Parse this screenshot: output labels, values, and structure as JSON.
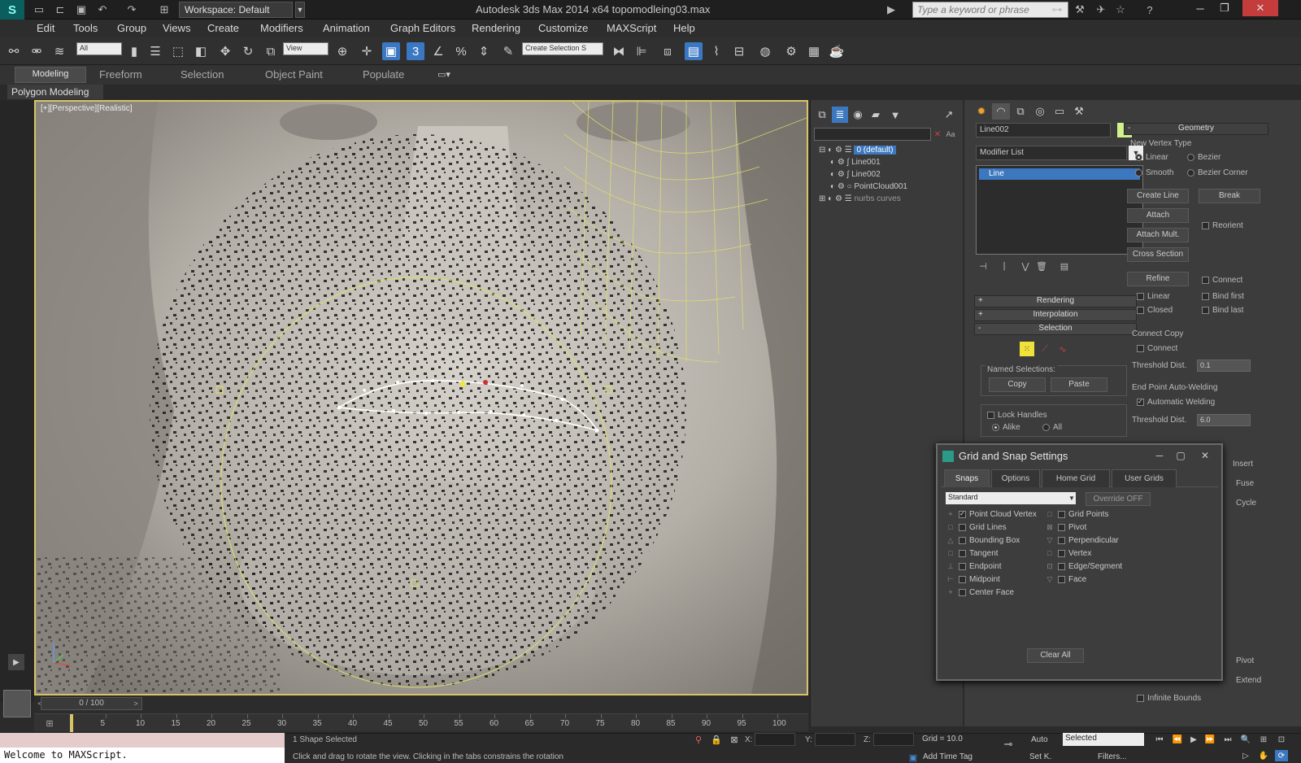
{
  "titlebar": {
    "workspace": "Workspace: Default",
    "title": "Autodesk 3ds Max  2014 x64      topomodleing03.max",
    "search_placeholder": "Type a keyword or phrase"
  },
  "menu": [
    "Edit",
    "Tools",
    "Group",
    "Views",
    "Create",
    "Modifiers",
    "Animation",
    "Graph Editors",
    "Rendering",
    "Customize",
    "MAXScript",
    "Help"
  ],
  "toolbar": {
    "filter_select": "All",
    "ref_coord_select": "View",
    "named_selection": "Create Selection S"
  },
  "ribbon": {
    "tabs": [
      "Modeling",
      "Freeform",
      "Selection",
      "Object Paint",
      "Populate"
    ],
    "panel_label": "Polygon Modeling"
  },
  "viewport": {
    "label": "[+][Perspective][Realistic]"
  },
  "timeline": {
    "slider": "0 / 100",
    "ticks": [
      "5",
      "10",
      "15",
      "20",
      "25",
      "30",
      "35",
      "40",
      "45",
      "50",
      "55",
      "60",
      "65",
      "70",
      "75",
      "80",
      "85",
      "90",
      "95",
      "100"
    ]
  },
  "scene_explorer": {
    "items": [
      "0 (default)",
      "Line001",
      "Line002",
      "PointCloud001",
      "nurbs curves"
    ]
  },
  "command_panel": {
    "object_name": "Line002",
    "modifier_list": "Modifier List",
    "stack_item": "Line",
    "rollouts": {
      "rendering": "Rendering",
      "interpolation": "Interpolation",
      "selection": "Selection"
    },
    "selection": {
      "named_selections": "Named Selections:",
      "copy": "Copy",
      "paste": "Paste",
      "lock_handles": "Lock Handles",
      "alike": "Alike",
      "all": "All"
    },
    "geometry": {
      "title": "Geometry",
      "new_vertex_type": "New Vertex Type",
      "linear": "Linear",
      "bezier": "Bezier",
      "smooth": "Smooth",
      "bezier_corner": "Bezier Corner",
      "create_line": "Create Line",
      "break": "Break",
      "attach": "Attach",
      "reorient": "Reorient",
      "attach_mult": "Attach Mult.",
      "cross_section": "Cross Section",
      "refine": "Refine",
      "connect": "Connect",
      "linear2": "Linear",
      "bind_first": "Bind first",
      "closed": "Closed",
      "bind_last": "Bind last",
      "connect_copy": "Connect Copy",
      "connect2": "Connect",
      "threshold_dist": "Threshold Dist.",
      "threshold_val1": "0.1",
      "end_point_welding": "End Point Auto-Welding",
      "automatic_welding": "Automatic Welding",
      "threshold_val2": "6.0",
      "insert": "Insert",
      "fuse": "Fuse",
      "cycle": "Cycle",
      "pivot": "Pivot",
      "extend": "Extend",
      "infinite_bounds": "Infinite Bounds"
    }
  },
  "grid_dialog": {
    "title": "Grid and Snap Settings",
    "tabs": [
      "Snaps",
      "Options",
      "Home Grid",
      "User Grids"
    ],
    "preset": "Standard",
    "override": "Override OFF",
    "left_snaps": [
      {
        "label": "Point Cloud Vertex",
        "checked": true,
        "glyph": "+"
      },
      {
        "label": "Grid Lines",
        "checked": false,
        "glyph": "□"
      },
      {
        "label": "Bounding Box",
        "checked": false,
        "glyph": "△"
      },
      {
        "label": "Tangent",
        "checked": false,
        "glyph": "□"
      },
      {
        "label": "Endpoint",
        "checked": false,
        "glyph": "⊥"
      },
      {
        "label": "Midpoint",
        "checked": false,
        "glyph": "⊢"
      },
      {
        "label": "Center Face",
        "checked": false,
        "glyph": "+"
      }
    ],
    "right_snaps": [
      {
        "label": "Grid Points",
        "checked": false,
        "glyph": "□"
      },
      {
        "label": "Pivot",
        "checked": false,
        "glyph": "⊠"
      },
      {
        "label": "Perpendicular",
        "checked": false,
        "glyph": "▽"
      },
      {
        "label": "Vertex",
        "checked": false,
        "glyph": "□"
      },
      {
        "label": "Edge/Segment",
        "checked": false,
        "glyph": "⊡"
      },
      {
        "label": "Face",
        "checked": false,
        "glyph": "▽"
      }
    ],
    "clear_all": "Clear All"
  },
  "status": {
    "listener": "Welcome to MAXScript.",
    "selection": "1 Shape Selected",
    "prompt": "Click and drag to rotate the view.  Clicking in the tabs constrains the rotation",
    "x_label": "X:",
    "y_label": "Y:",
    "z_label": "Z:",
    "grid": "Grid = 10.0",
    "add_time_tag": "Add Time Tag",
    "auto": "Auto",
    "set_key": "Set K.",
    "selected": "Selected",
    "filters": "Filters..."
  },
  "colors": {
    "accent": "#3c78c0",
    "viewport_border": "#d8c468",
    "object_color": "#d2f08c"
  }
}
